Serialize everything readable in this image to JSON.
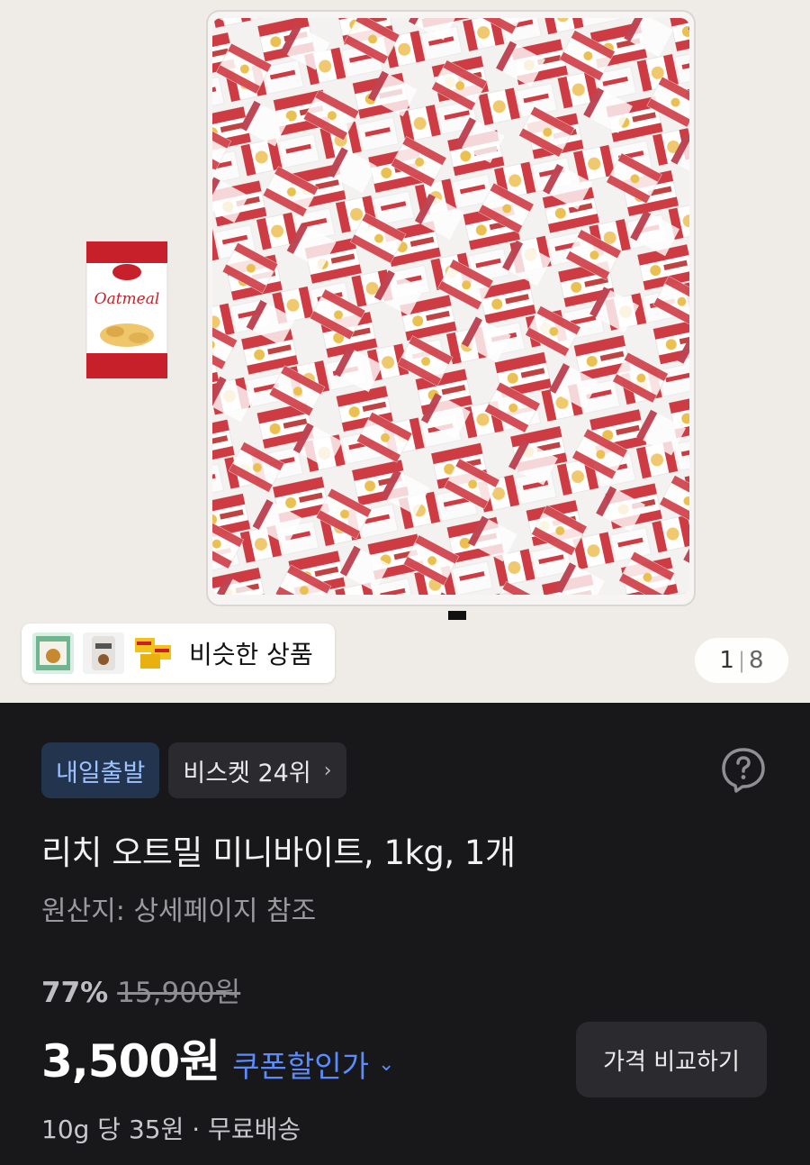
{
  "gallery": {
    "current_page": "1",
    "total_pages": "8",
    "separator": "|",
    "similar_label": "비슷한 상품",
    "single_pack_text": "Oatmeal"
  },
  "product": {
    "badge_delivery": "내일출발",
    "badge_rank": "비스켓 24위",
    "title": "리치 오트밀 미니바이트, 1kg, 1개",
    "origin": "원산지: 상세페이지 참조",
    "discount_percent": "77%",
    "original_price": "15,900원",
    "sale_price": "3,500원",
    "coupon_label": "쿠폰할인가",
    "compare_button": "가격 비교하기",
    "unit_info": "10g 당 35원 · 무료배송"
  },
  "icons": {
    "help": "question-circle-icon",
    "rank_chevron": "chevron-right-icon",
    "coupon_chevron": "chevron-down-icon"
  },
  "colors": {
    "panel_bg": "#18181b",
    "accent_blue": "#5a8cff",
    "package_red": "#c8202a"
  }
}
